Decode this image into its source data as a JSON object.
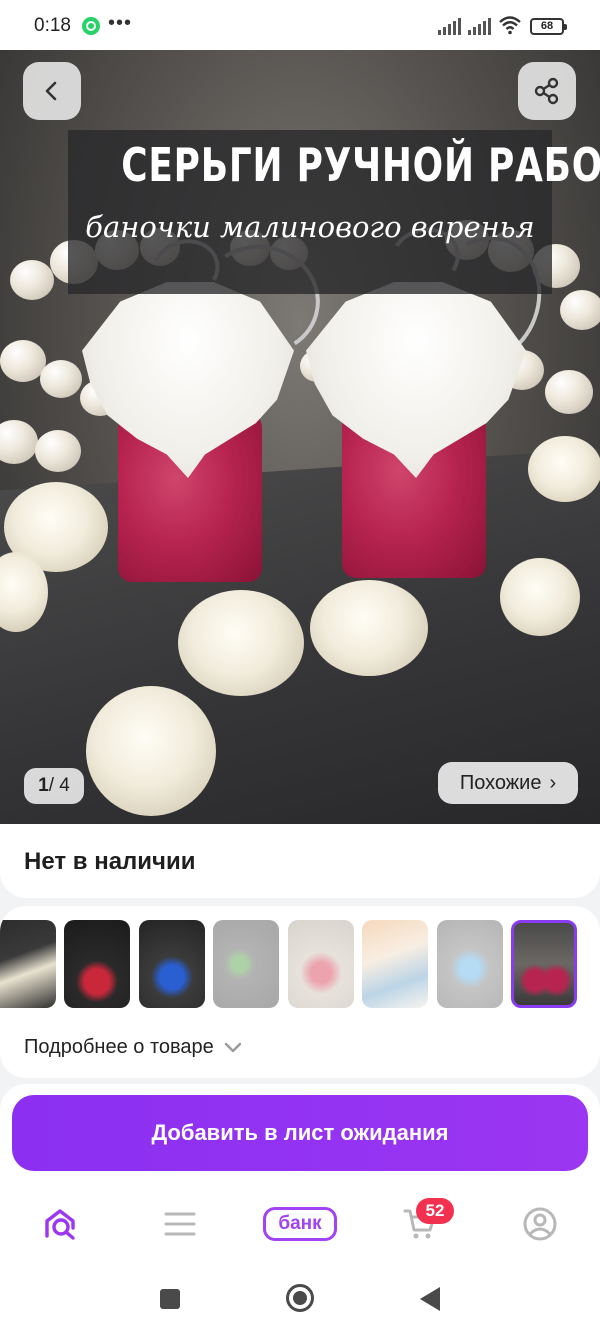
{
  "status_bar": {
    "time": "0:18",
    "battery": "68",
    "icons": [
      "whatsapp-icon",
      "more-dots-icon",
      "signal-icon",
      "signal-icon",
      "wifi-icon",
      "battery-icon"
    ]
  },
  "hero": {
    "title": "СЕРЬГИ РУЧНОЙ РАБОТЫ",
    "subtitle": "баночки малинового варенья",
    "counter_current": "1",
    "counter_separator": "/",
    "counter_total": "4",
    "similar_label": "Похожие",
    "similar_chevron": "›",
    "back_icon": "chevron-left-icon",
    "share_icon": "share-icon"
  },
  "product": {
    "availability": "Нет в наличии",
    "details_link": "Подробнее о товаре"
  },
  "gallery": {
    "selected_index": 7,
    "thumbnails": [
      {
        "name": "thumb-white-flower-earrings"
      },
      {
        "name": "thumb-strawberry-earrings"
      },
      {
        "name": "thumb-blueberry-earrings"
      },
      {
        "name": "thumb-green-earrings"
      },
      {
        "name": "thumb-strawberry-studs"
      },
      {
        "name": "thumb-anime-earrings"
      },
      {
        "name": "thumb-blue-flower-earrings"
      },
      {
        "name": "thumb-jam-jar-earrings"
      }
    ]
  },
  "cta": {
    "label": "Добавить в лист ожидания"
  },
  "tabbar": {
    "bank_label": "банк",
    "cart_count": "52",
    "accent": "#a043f4",
    "badge_color": "#f2304f"
  },
  "colors": {
    "cta": "#8b2ff1",
    "selected_border": "#8a3cf0"
  }
}
